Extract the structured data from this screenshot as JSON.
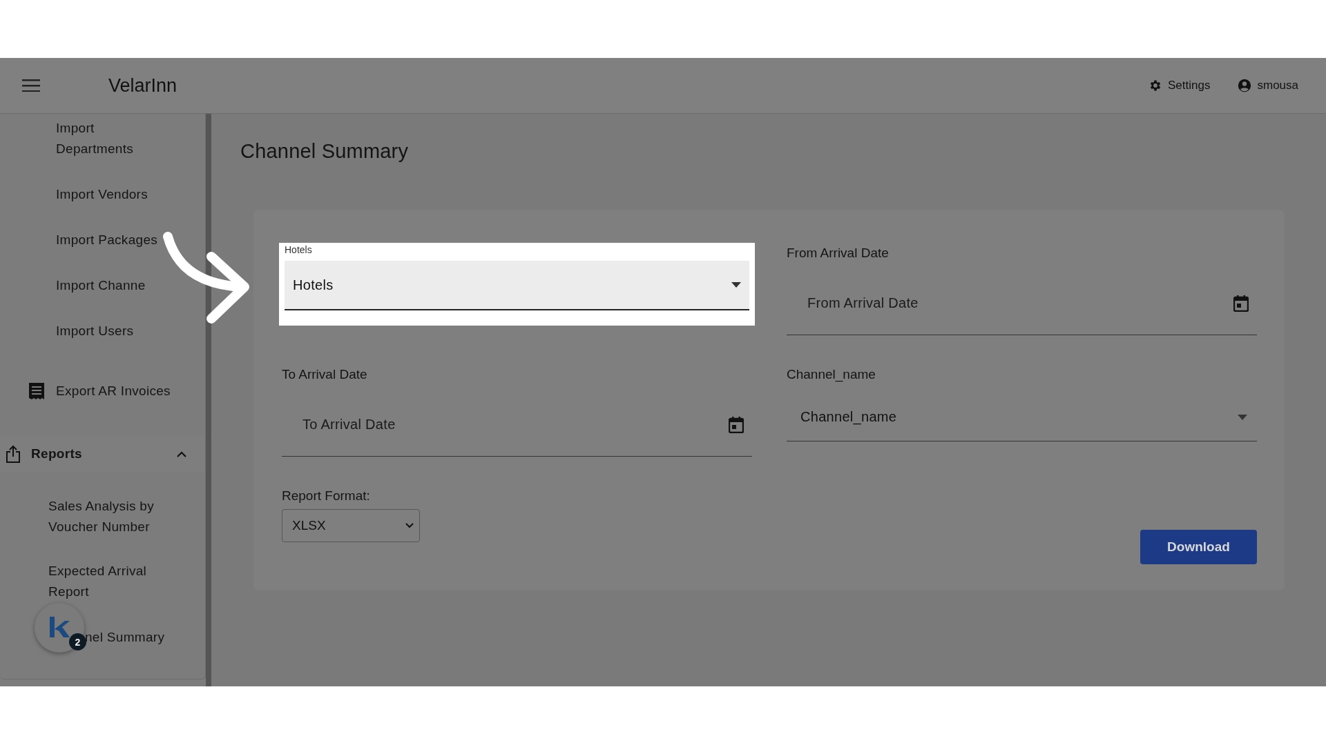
{
  "header": {
    "title": "VelarInn",
    "settings": "Settings",
    "user": "smousa"
  },
  "sidebar": {
    "items": [
      {
        "label": "Import Departments"
      },
      {
        "label": "Import Vendors"
      },
      {
        "label": "Import Packages"
      },
      {
        "label": "Import Channe"
      },
      {
        "label": "Import Users"
      }
    ],
    "export": {
      "label": "Export AR Invoices"
    },
    "reports": {
      "label": "Reports",
      "expanded": true,
      "items": [
        {
          "label": "Sales Analysis by Voucher Number"
        },
        {
          "label": "Expected Arrival Report"
        },
        {
          "label": "nel Summary"
        }
      ]
    }
  },
  "page": {
    "title": "Channel Summary"
  },
  "form": {
    "fields": [
      {
        "kind": "select",
        "label": "Hotels",
        "value": "Hotels",
        "highlighted": true
      },
      {
        "kind": "date",
        "label": "From Arrival Date",
        "placeholder": "From Arrival Date",
        "highlighted": false
      },
      {
        "kind": "date",
        "label": "To Arrival Date",
        "placeholder": "To Arrival Date",
        "highlighted": false
      },
      {
        "kind": "select",
        "label": "Channel_name",
        "value": "Channel_name",
        "highlighted": false
      }
    ],
    "report_format": {
      "label": "Report Format:",
      "value": "XLSX"
    },
    "download": "Download"
  },
  "chat_widget": {
    "badge": "2"
  }
}
